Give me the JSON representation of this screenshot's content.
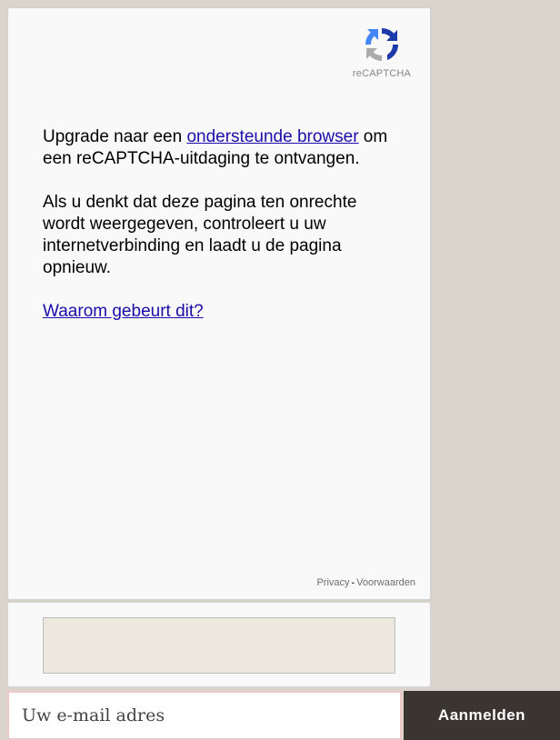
{
  "captcha": {
    "logo_text": "reCAPTCHA",
    "message_line1_before": "Upgrade naar een ",
    "message_link": "ondersteunde browser",
    "message_line1_after": " om een reCAPTCHA-uitdaging te ontvangen.",
    "message_paragraph2": "Als u denkt dat deze pagina ten onrechte wordt weergegeven, controleert u uw internetverbinding en laadt u de pagina opnieuw.",
    "why_link": "Waarom gebeurt dit?",
    "privacy_link": "Privacy",
    "separator": "-",
    "terms_link": "Voorwaarden"
  },
  "signup": {
    "email_placeholder": "Uw e-mail adres",
    "email_value": "",
    "submit_label": "Aanmelden"
  },
  "colors": {
    "background": "#dbd4cc",
    "card_background": "#f9f9f9",
    "link": "#1a0dab",
    "button_background": "#3a3530",
    "response_field": "#ece8de"
  },
  "icons": {
    "logo": "recaptcha-logo-icon"
  }
}
